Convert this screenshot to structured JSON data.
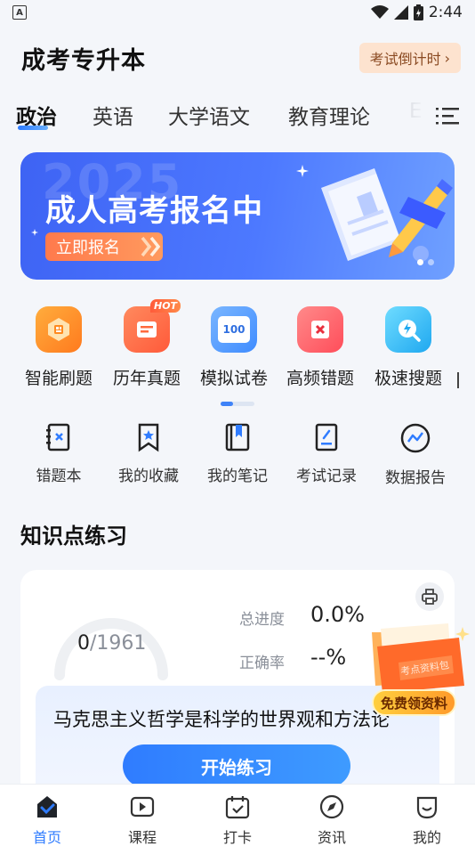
{
  "status_bar": {
    "time": "2:44",
    "app_badge": "A"
  },
  "header": {
    "title": "成考专升本",
    "countdown_label": "考试倒计时",
    "countdown_chevron": "›"
  },
  "subject_tabs": [
    {
      "label": "政治",
      "active": true
    },
    {
      "label": "英语",
      "active": false
    },
    {
      "label": "大学语文",
      "active": false
    },
    {
      "label": "教育理论",
      "active": false
    },
    {
      "label": "E",
      "active": false
    }
  ],
  "banner": {
    "year": "2025",
    "title": "成人高考报名中",
    "cta": "立即报名",
    "slide_count": 2,
    "active_slide": 1
  },
  "features": [
    {
      "label": "智能刷题",
      "icon": "smart-practice-icon",
      "color": "#ff8a1e",
      "hot": false
    },
    {
      "label": "历年真题",
      "icon": "past-exams-icon",
      "color": "#ff6a3d",
      "hot": true,
      "badge": "HOT"
    },
    {
      "label": "模拟试卷",
      "icon": "mock-paper-icon",
      "color": "#3f8cff",
      "hot": false,
      "icon_text": "100"
    },
    {
      "label": "高频错题",
      "icon": "frequent-mistakes-icon",
      "color": "#ff4d5a",
      "hot": false
    },
    {
      "label": "极速搜题",
      "icon": "quick-search-icon",
      "color": "#29b6f6",
      "hot": false
    }
  ],
  "tools": [
    {
      "label": "错题本",
      "icon": "mistake-book-icon"
    },
    {
      "label": "我的收藏",
      "icon": "bookmark-icon"
    },
    {
      "label": "我的笔记",
      "icon": "notes-icon"
    },
    {
      "label": "考试记录",
      "icon": "exam-record-icon"
    },
    {
      "label": "数据报告",
      "icon": "data-report-icon"
    }
  ],
  "knowledge": {
    "section_title": "知识点练习",
    "progress_done": "0",
    "progress_total": "/1961",
    "progress_fraction": 0,
    "total_progress_label": "总进度",
    "total_progress_value": "0.0%",
    "accuracy_label": "正确率",
    "accuracy_value": "--%",
    "chapter_title": "马克思主义哲学是科学的世界观和方法论",
    "start_button": "开始练习"
  },
  "promo": {
    "label": "免费领资料",
    "folder_text": "考点资料包"
  },
  "bottom_nav": [
    {
      "label": "首页",
      "icon": "home-icon",
      "active": true
    },
    {
      "label": "课程",
      "icon": "course-icon",
      "active": false
    },
    {
      "label": "打卡",
      "icon": "checkin-icon",
      "active": false
    },
    {
      "label": "资讯",
      "icon": "news-icon",
      "active": false
    },
    {
      "label": "我的",
      "icon": "profile-icon",
      "active": false
    }
  ],
  "colors": {
    "accent": "#2f7cff",
    "banner": "#4d79ff",
    "countdown_bg": "#fde3cf"
  }
}
